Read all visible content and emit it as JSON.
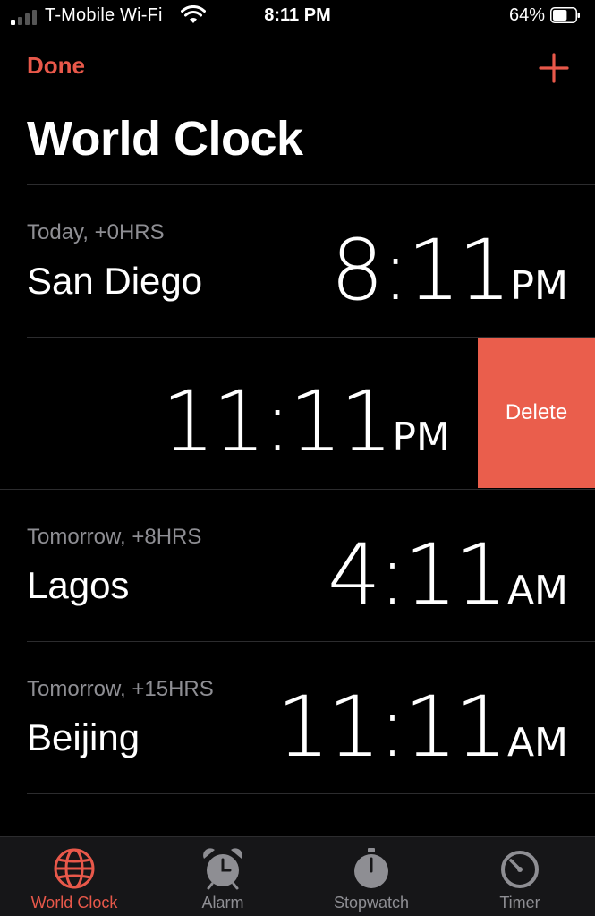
{
  "colors": {
    "accent": "#E8584A",
    "delete": "#EA5E4C",
    "background": "#000000",
    "secondary_text": "#8e8e93",
    "tab_inactive": "#8e8e93"
  },
  "status_bar": {
    "carrier": "T-Mobile Wi-Fi",
    "time": "8:11 PM",
    "battery_percent": "64%",
    "battery_level": 0.64,
    "signal_bars_filled": 1,
    "signal_bars_total": 4
  },
  "nav": {
    "done_label": "Done",
    "add_icon": "plus-icon",
    "title": "World Clock"
  },
  "clocks": [
    {
      "subtitle": "Today, +0HRS",
      "city": "San Diego",
      "time": "8:11",
      "ampm": "PM",
      "swiped": false
    },
    {
      "subtitle": "",
      "city": "",
      "time": "11:11",
      "ampm": "PM",
      "swiped": true,
      "delete_label": "Delete"
    },
    {
      "subtitle": "Tomorrow, +8HRS",
      "city": "Lagos",
      "time": "4:11",
      "ampm": "AM",
      "swiped": false
    },
    {
      "subtitle": "Tomorrow, +15HRS",
      "city": "Beijing",
      "time": "11:11",
      "ampm": "AM",
      "swiped": false
    }
  ],
  "tabs": [
    {
      "label": "World Clock",
      "icon": "globe-icon",
      "active": true
    },
    {
      "label": "Alarm",
      "icon": "alarm-clock-icon",
      "active": false
    },
    {
      "label": "Stopwatch",
      "icon": "stopwatch-icon",
      "active": false
    },
    {
      "label": "Timer",
      "icon": "timer-icon",
      "active": false
    }
  ]
}
